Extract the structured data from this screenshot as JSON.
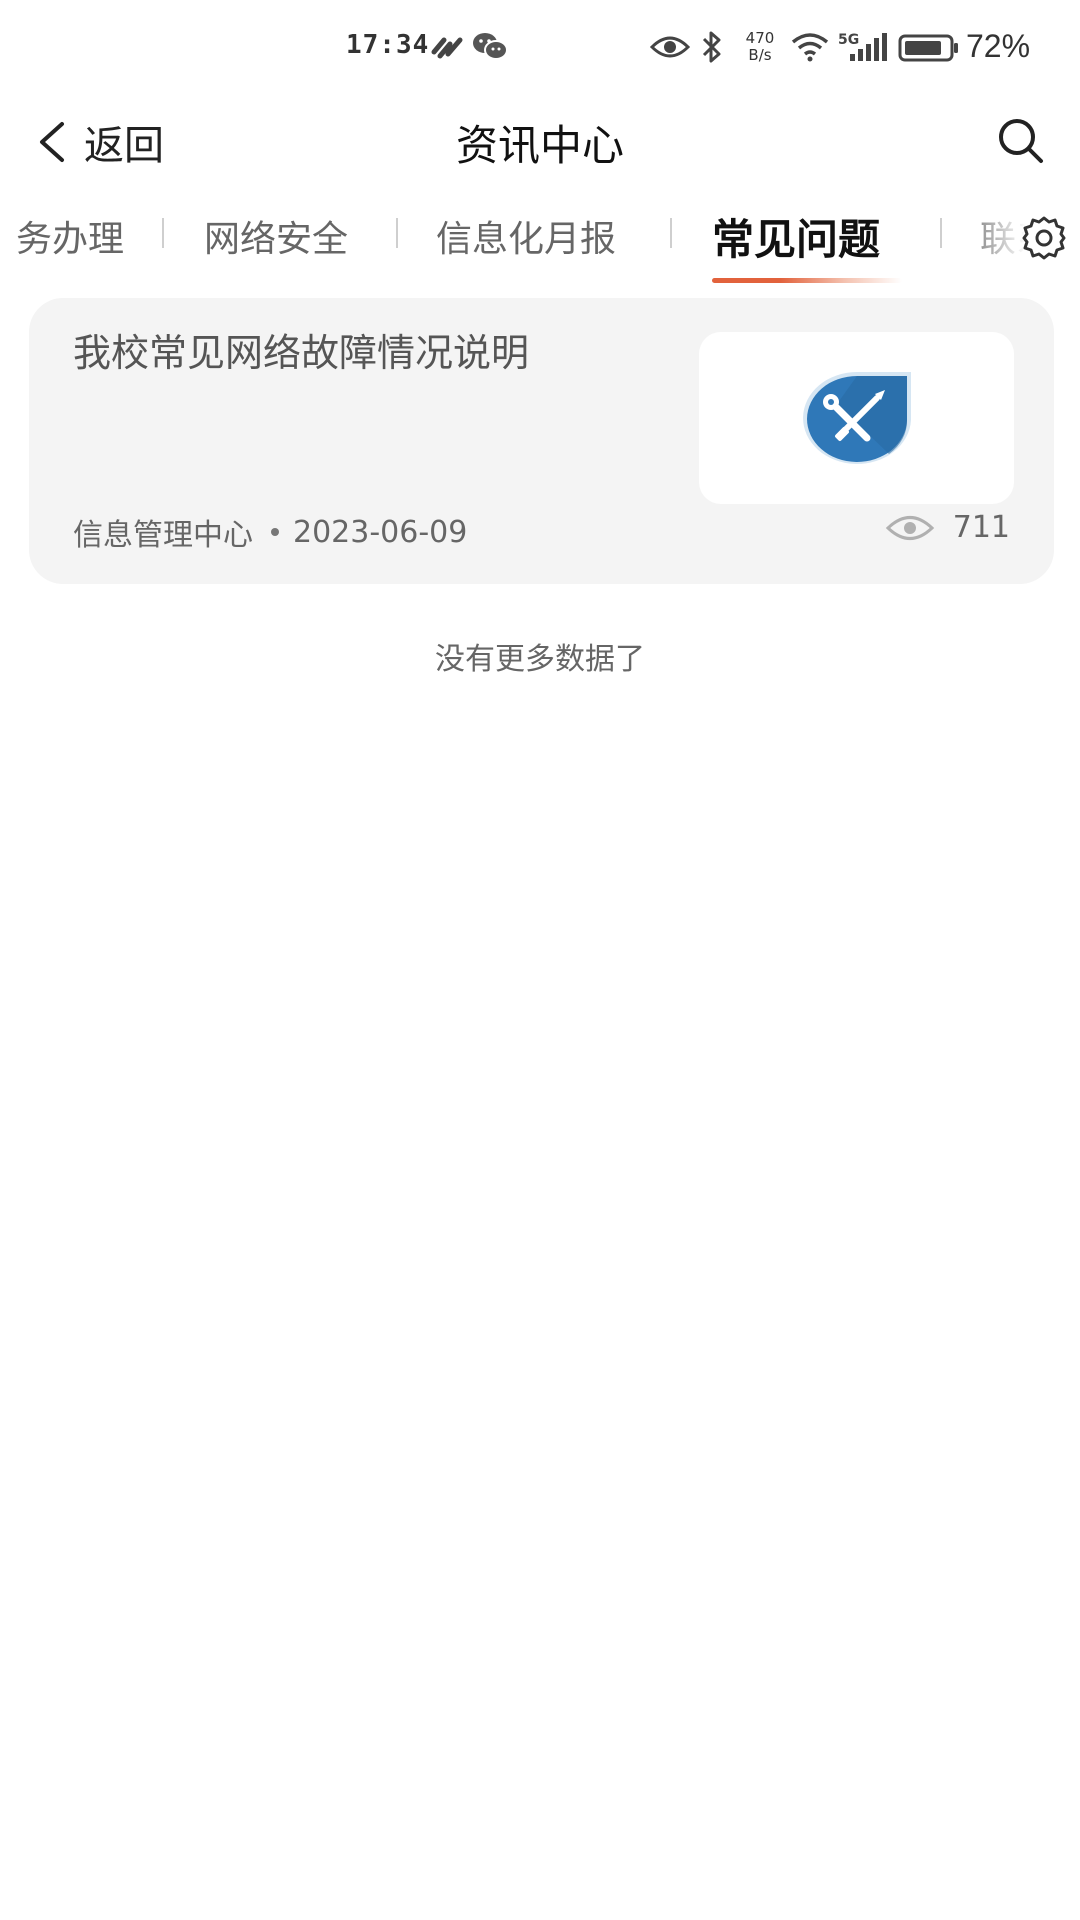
{
  "status_bar": {
    "time": "17:34",
    "net_speed_value": "470",
    "net_speed_unit": "B/s",
    "network": "5G",
    "battery_percent": "72%"
  },
  "header": {
    "back_label": "返回",
    "title": "资讯中心"
  },
  "tabs": [
    {
      "label": "务办理",
      "active": false
    },
    {
      "label": "网络安全",
      "active": false
    },
    {
      "label": "信息化月报",
      "active": false
    },
    {
      "label": "常见问题",
      "active": true
    },
    {
      "label": "联系",
      "active": false
    }
  ],
  "articles": [
    {
      "title": "我校常见网络故障情况说明",
      "source": "信息管理中心",
      "date": "2023-06-09",
      "views": "711",
      "thumbnail_icon": "tools-icon"
    }
  ],
  "list_footer": "没有更多数据了",
  "colors": {
    "accent": "#e2623c",
    "card_bg": "#f4f4f4",
    "icon_blue": "#2f78b8"
  }
}
